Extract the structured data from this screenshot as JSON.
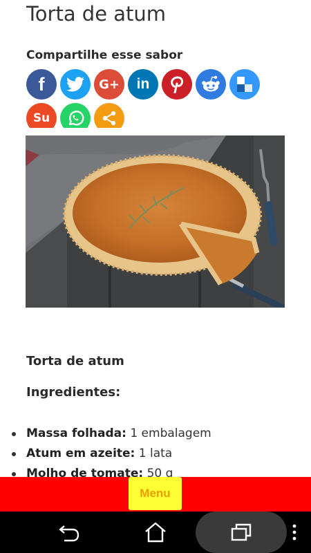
{
  "article": {
    "title": "Torta de atum"
  },
  "share": {
    "heading": "Compartilhe esse sabor",
    "buttons": [
      {
        "name": "facebook",
        "glyph": "f",
        "color": "#3b5998"
      },
      {
        "name": "twitter",
        "glyph": "",
        "color": "#1da1f2"
      },
      {
        "name": "google-plus",
        "glyph": "G+",
        "color": "#dd4b39"
      },
      {
        "name": "linkedin",
        "glyph": "in",
        "color": "#0077b5"
      },
      {
        "name": "pinterest",
        "glyph": "",
        "color": "#cb2027"
      },
      {
        "name": "reddit",
        "glyph": "",
        "color": "#2f7be0"
      },
      {
        "name": "delicious",
        "glyph": "",
        "color": "#3399ff"
      },
      {
        "name": "stumbleupon",
        "glyph": "Su",
        "color": "#eb4924"
      },
      {
        "name": "whatsapp",
        "glyph": "",
        "color": "#25d366"
      },
      {
        "name": "share",
        "glyph": "",
        "color": "#f39c12"
      }
    ]
  },
  "recipe": {
    "title": "Torta de atum",
    "ingredients_heading": "Ingredientes:",
    "ingredients": [
      {
        "name": "Massa folhada:",
        "qty": " 1 embalagem"
      },
      {
        "name": "Atum em azeite:",
        "qty": " 1 lata"
      },
      {
        "name": "Molho de tomate:",
        "qty": " 50 g"
      }
    ]
  },
  "menu": {
    "label": "Menu"
  },
  "colors": {
    "menu_bar": "#ff0000",
    "menu_button": "#ffff33",
    "menu_text": "#e8a000"
  }
}
